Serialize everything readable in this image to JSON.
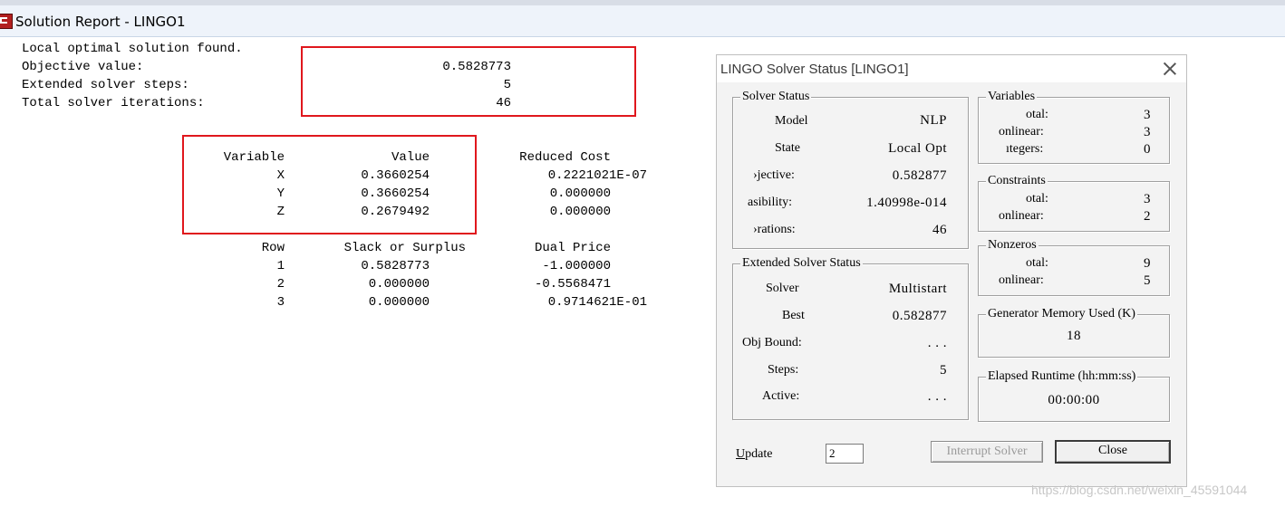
{
  "window": {
    "title": "Solution Report - LINGO1"
  },
  "report": {
    "status_line": "Local optimal solution found.",
    "summary": [
      {
        "label": "Objective value:",
        "value": "0.5828773"
      },
      {
        "label": "Extended solver steps:",
        "value": "5"
      },
      {
        "label": "Total solver iterations:",
        "value": "46"
      }
    ],
    "variable_headers": {
      "variable": "Variable",
      "value": "Value",
      "reduced_cost": "Reduced Cost"
    },
    "variables": [
      {
        "name": "X",
        "value": "0.3660254",
        "reduced_cost": "0.2221021E-07"
      },
      {
        "name": "Y",
        "value": "0.3660254",
        "reduced_cost": "0.000000"
      },
      {
        "name": "Z",
        "value": "0.2679492",
        "reduced_cost": "0.000000"
      }
    ],
    "row_headers": {
      "row": "Row",
      "slack": "Slack or Surplus",
      "dual": "Dual Price"
    },
    "rows": [
      {
        "row": "1",
        "slack": "0.5828773",
        "dual": "-1.000000"
      },
      {
        "row": "2",
        "slack": "0.000000",
        "dual": "-0.5568471"
      },
      {
        "row": "3",
        "slack": "0.000000",
        "dual": "0.9714621E-01"
      }
    ]
  },
  "dialog": {
    "title": "LINGO Solver Status [LINGO1]",
    "solver_status": {
      "legend": "Solver Status",
      "model_label": "Model",
      "model_value": "NLP",
      "state_label": "State",
      "state_value": "Local Opt",
      "objective_label": "›jective:",
      "objective_value": "0.582877",
      "infeasibility_label": "asibility:",
      "infeasibility_value": "1.40998e-014",
      "iterations_label": "›rations:",
      "iterations_value": "46"
    },
    "extended_status": {
      "legend": "Extended Solver Status",
      "solver_label": "Solver",
      "solver_value": "Multistart",
      "best_label": "Best",
      "best_value": "0.582877",
      "objbound_label": "Obj Bound:",
      "objbound_value": ". . .",
      "steps_label": "Steps:",
      "steps_value": "5",
      "active_label": "Active:",
      "active_value": ". . ."
    },
    "variables": {
      "legend": "Variables",
      "total_label": "otal:",
      "total_value": "3",
      "nonlinear_label": "onlinear:",
      "nonlinear_value": "3",
      "integers_label": "ıtegers:",
      "integers_value": "0"
    },
    "constraints": {
      "legend": "Constraints",
      "total_label": "otal:",
      "total_value": "3",
      "nonlinear_label": "onlinear:",
      "nonlinear_value": "2"
    },
    "nonzeros": {
      "legend": "Nonzeros",
      "total_label": "otal:",
      "total_value": "9",
      "nonlinear_label": "onlinear:",
      "nonlinear_value": "5"
    },
    "memory": {
      "legend": "Generator Memory Used (K)",
      "value": "18"
    },
    "runtime": {
      "legend": "Elapsed Runtime (hh:mm:ss)",
      "value": "00:00:00"
    },
    "update_label": "Update",
    "update_value": "2",
    "interrupt_label": "Interrupt Solver",
    "close_label": "Close"
  },
  "watermark": "https://blog.csdn.net/weixin_45591044",
  "colors": {
    "highlight": "#e0171d",
    "titlebar": "#eef3fa",
    "dialog_bg": "#f3f3f3"
  }
}
